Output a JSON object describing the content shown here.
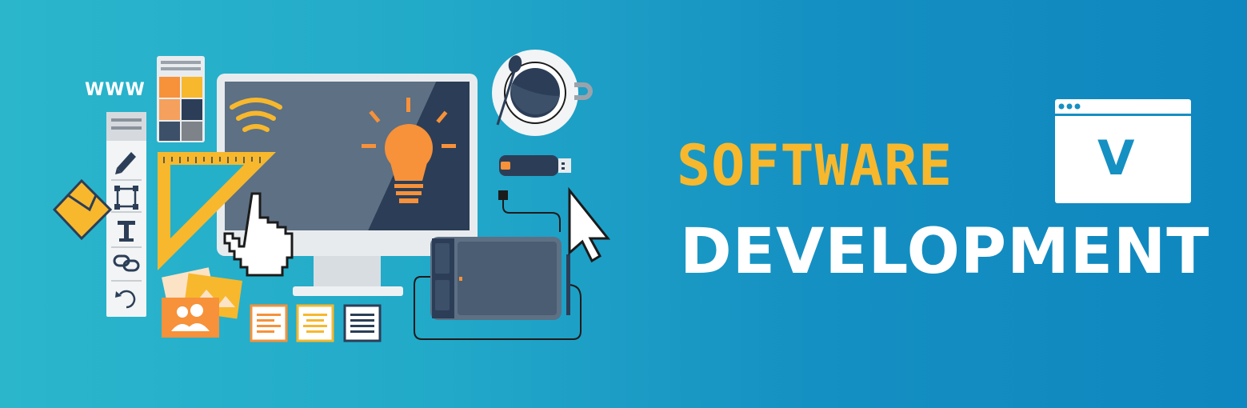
{
  "banner": {
    "www_label": "WWW",
    "title_line1": "SOFTWARE",
    "title_line2": "DEVELOPMENT",
    "check_mark": "V"
  },
  "colors": {
    "background_left": "#2bb6cc",
    "background_right": "#0e86bf",
    "accent_yellow": "#f7b82d",
    "accent_orange": "#f7913a",
    "navy": "#2c3e57",
    "white": "#ffffff"
  },
  "icons": [
    "monitor-icon",
    "lightbulb-icon",
    "wifi-icon",
    "pointer-hand-icon",
    "ruler-triangle-icon",
    "color-palette-icon",
    "toolbar-icon",
    "pencil-icon",
    "crop-icon",
    "text-icon",
    "link-icon",
    "refresh-icon",
    "envelope-icon",
    "photos-icon",
    "document-icon",
    "coffee-cup-icon",
    "usb-drive-icon",
    "drawing-tablet-icon",
    "cursor-arrow-icon",
    "browser-check-icon"
  ]
}
